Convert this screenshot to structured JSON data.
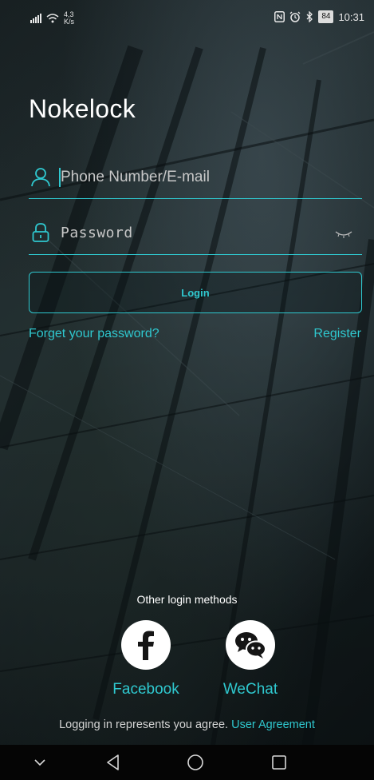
{
  "status_bar": {
    "network_speed_value": "4,3",
    "network_speed_unit": "K/s",
    "battery": "84",
    "time": "10:31"
  },
  "app": {
    "title": "Nokelock"
  },
  "form": {
    "phone_placeholder": "Phone Number/E-mail",
    "password_placeholder": "Password",
    "login_label": "Login",
    "forgot_label": "Forget your password?",
    "register_label": "Register"
  },
  "other_login": {
    "title": "Other login methods",
    "methods": [
      {
        "label": "Facebook",
        "icon": "facebook-icon"
      },
      {
        "label": "WeChat",
        "icon": "wechat-icon"
      }
    ]
  },
  "agreement": {
    "text": "Logging in represents you agree.",
    "link": "User Agreement"
  },
  "colors": {
    "accent": "#2fc8cf",
    "text": "#ffffff",
    "navbar": "#050505"
  }
}
